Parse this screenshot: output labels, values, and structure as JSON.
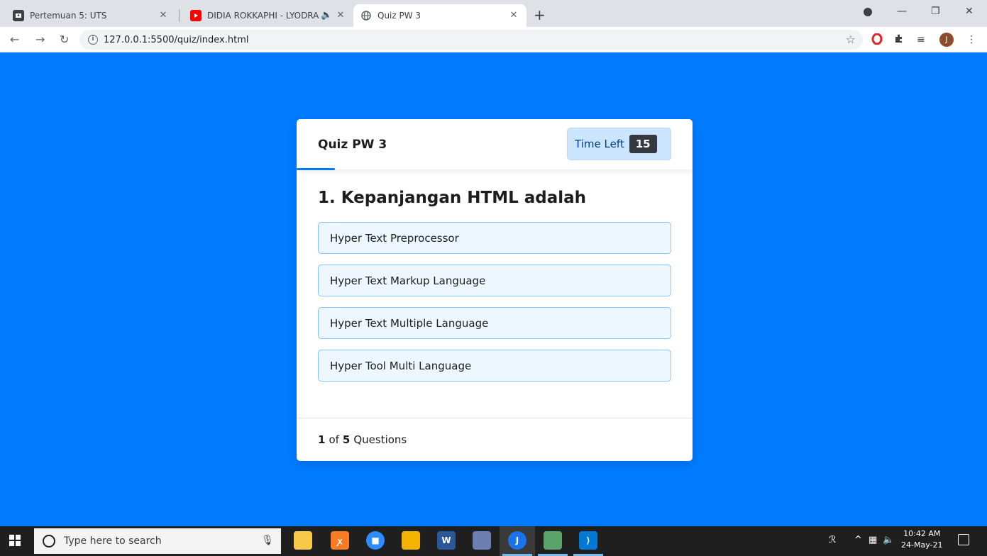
{
  "browser": {
    "tabs": [
      {
        "title": "Pertemuan 5: UTS",
        "icon": "classroom-icon"
      },
      {
        "title": "DIDIA ROKKAPHI - LYODRA (",
        "icon": "youtube-icon",
        "audio": true
      },
      {
        "title": "Quiz PW 3",
        "icon": "globe-icon",
        "active": true
      }
    ],
    "url": "127.0.0.1:5500/quiz/index.html",
    "profile_initial": "J"
  },
  "quiz": {
    "title": "Quiz PW 3",
    "timer_label": "Time Left",
    "timer_value": "15",
    "question": "1. Kepanjangan HTML adalah",
    "options": [
      "Hyper Text Preprocessor",
      "Hyper Text Markup Language",
      "Hyper Text Multiple Language",
      "Hyper Tool Multi Language"
    ],
    "progress": {
      "current": "1",
      "of_text": "of",
      "total": "5",
      "suffix": "Questions"
    }
  },
  "taskbar": {
    "search_placeholder": "Type here to search",
    "time": "10:42 AM",
    "date": "24-May-21"
  },
  "colors": {
    "page_bg": "#007bff",
    "timer_bg": "#cce5ff",
    "timer_badge": "#343a40",
    "option_border": "#84c5fe",
    "option_bg": "#eef7ff"
  }
}
